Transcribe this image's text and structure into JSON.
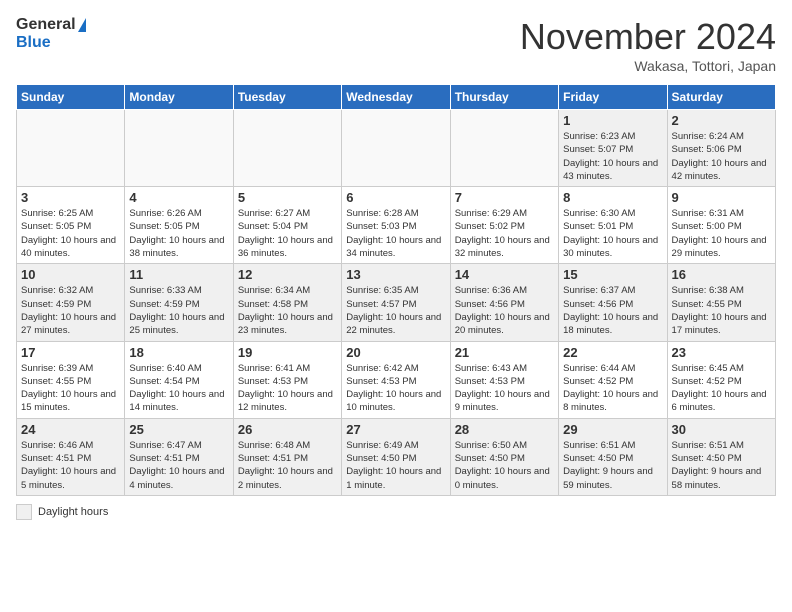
{
  "logo": {
    "general": "General",
    "blue": "Blue"
  },
  "title": "November 2024",
  "location": "Wakasa, Tottori, Japan",
  "days_of_week": [
    "Sunday",
    "Monday",
    "Tuesday",
    "Wednesday",
    "Thursday",
    "Friday",
    "Saturday"
  ],
  "footer": {
    "swatch_label": "Daylight hours"
  },
  "weeks": [
    [
      {
        "day": "",
        "info": ""
      },
      {
        "day": "",
        "info": ""
      },
      {
        "day": "",
        "info": ""
      },
      {
        "day": "",
        "info": ""
      },
      {
        "day": "",
        "info": ""
      },
      {
        "day": "1",
        "info": "Sunrise: 6:23 AM\nSunset: 5:07 PM\nDaylight: 10 hours and 43 minutes."
      },
      {
        "day": "2",
        "info": "Sunrise: 6:24 AM\nSunset: 5:06 PM\nDaylight: 10 hours and 42 minutes."
      }
    ],
    [
      {
        "day": "3",
        "info": "Sunrise: 6:25 AM\nSunset: 5:05 PM\nDaylight: 10 hours and 40 minutes."
      },
      {
        "day": "4",
        "info": "Sunrise: 6:26 AM\nSunset: 5:05 PM\nDaylight: 10 hours and 38 minutes."
      },
      {
        "day": "5",
        "info": "Sunrise: 6:27 AM\nSunset: 5:04 PM\nDaylight: 10 hours and 36 minutes."
      },
      {
        "day": "6",
        "info": "Sunrise: 6:28 AM\nSunset: 5:03 PM\nDaylight: 10 hours and 34 minutes."
      },
      {
        "day": "7",
        "info": "Sunrise: 6:29 AM\nSunset: 5:02 PM\nDaylight: 10 hours and 32 minutes."
      },
      {
        "day": "8",
        "info": "Sunrise: 6:30 AM\nSunset: 5:01 PM\nDaylight: 10 hours and 30 minutes."
      },
      {
        "day": "9",
        "info": "Sunrise: 6:31 AM\nSunset: 5:00 PM\nDaylight: 10 hours and 29 minutes."
      }
    ],
    [
      {
        "day": "10",
        "info": "Sunrise: 6:32 AM\nSunset: 4:59 PM\nDaylight: 10 hours and 27 minutes."
      },
      {
        "day": "11",
        "info": "Sunrise: 6:33 AM\nSunset: 4:59 PM\nDaylight: 10 hours and 25 minutes."
      },
      {
        "day": "12",
        "info": "Sunrise: 6:34 AM\nSunset: 4:58 PM\nDaylight: 10 hours and 23 minutes."
      },
      {
        "day": "13",
        "info": "Sunrise: 6:35 AM\nSunset: 4:57 PM\nDaylight: 10 hours and 22 minutes."
      },
      {
        "day": "14",
        "info": "Sunrise: 6:36 AM\nSunset: 4:56 PM\nDaylight: 10 hours and 20 minutes."
      },
      {
        "day": "15",
        "info": "Sunrise: 6:37 AM\nSunset: 4:56 PM\nDaylight: 10 hours and 18 minutes."
      },
      {
        "day": "16",
        "info": "Sunrise: 6:38 AM\nSunset: 4:55 PM\nDaylight: 10 hours and 17 minutes."
      }
    ],
    [
      {
        "day": "17",
        "info": "Sunrise: 6:39 AM\nSunset: 4:55 PM\nDaylight: 10 hours and 15 minutes."
      },
      {
        "day": "18",
        "info": "Sunrise: 6:40 AM\nSunset: 4:54 PM\nDaylight: 10 hours and 14 minutes."
      },
      {
        "day": "19",
        "info": "Sunrise: 6:41 AM\nSunset: 4:53 PM\nDaylight: 10 hours and 12 minutes."
      },
      {
        "day": "20",
        "info": "Sunrise: 6:42 AM\nSunset: 4:53 PM\nDaylight: 10 hours and 10 minutes."
      },
      {
        "day": "21",
        "info": "Sunrise: 6:43 AM\nSunset: 4:53 PM\nDaylight: 10 hours and 9 minutes."
      },
      {
        "day": "22",
        "info": "Sunrise: 6:44 AM\nSunset: 4:52 PM\nDaylight: 10 hours and 8 minutes."
      },
      {
        "day": "23",
        "info": "Sunrise: 6:45 AM\nSunset: 4:52 PM\nDaylight: 10 hours and 6 minutes."
      }
    ],
    [
      {
        "day": "24",
        "info": "Sunrise: 6:46 AM\nSunset: 4:51 PM\nDaylight: 10 hours and 5 minutes."
      },
      {
        "day": "25",
        "info": "Sunrise: 6:47 AM\nSunset: 4:51 PM\nDaylight: 10 hours and 4 minutes."
      },
      {
        "day": "26",
        "info": "Sunrise: 6:48 AM\nSunset: 4:51 PM\nDaylight: 10 hours and 2 minutes."
      },
      {
        "day": "27",
        "info": "Sunrise: 6:49 AM\nSunset: 4:50 PM\nDaylight: 10 hours and 1 minute."
      },
      {
        "day": "28",
        "info": "Sunrise: 6:50 AM\nSunset: 4:50 PM\nDaylight: 10 hours and 0 minutes."
      },
      {
        "day": "29",
        "info": "Sunrise: 6:51 AM\nSunset: 4:50 PM\nDaylight: 9 hours and 59 minutes."
      },
      {
        "day": "30",
        "info": "Sunrise: 6:51 AM\nSunset: 4:50 PM\nDaylight: 9 hours and 58 minutes."
      }
    ]
  ]
}
